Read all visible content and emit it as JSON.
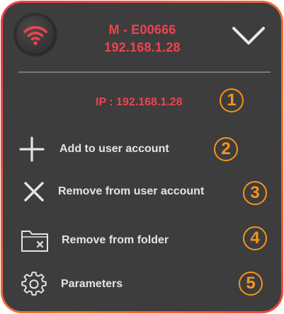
{
  "device": {
    "name": "M - E00666",
    "ip": "192.168.1.28"
  },
  "info": {
    "ip_line": "IP : 192.168.1.28"
  },
  "menu": {
    "items": [
      {
        "label": "Add to user account",
        "icon": "plus-icon"
      },
      {
        "label": "Remove from user account",
        "icon": "x-icon"
      },
      {
        "label": "Remove from folder",
        "icon": "folder-remove-icon"
      },
      {
        "label": "Parameters",
        "icon": "gear-icon"
      }
    ]
  },
  "badges": [
    "1",
    "2",
    "3",
    "4",
    "5"
  ],
  "colors": {
    "accent_red": "#f0434f",
    "badge_orange": "#f7941d",
    "panel_bg": "#3d3d3d",
    "border_gradient": [
      "#e83c4e",
      "#f2772e"
    ],
    "text_light": "#e4e4e4"
  }
}
